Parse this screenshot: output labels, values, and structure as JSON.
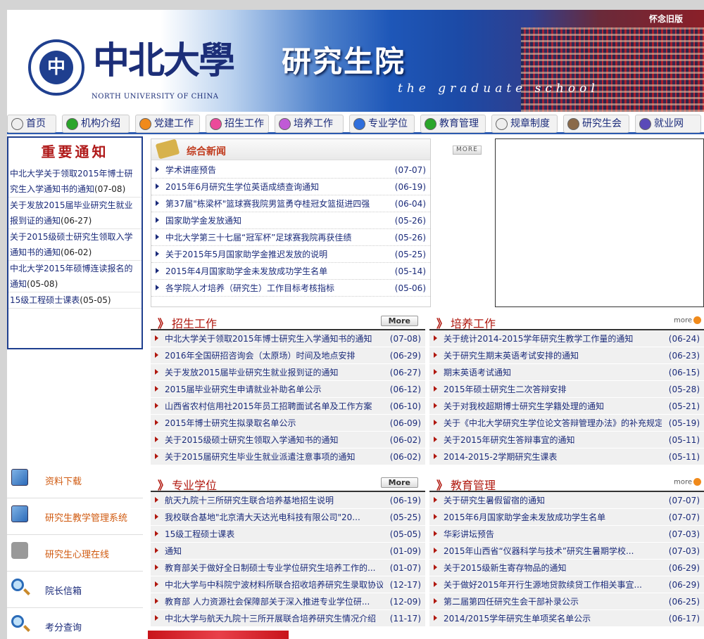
{
  "header": {
    "logo_cn": "中北大學",
    "logo_en": "NORTH UNIVERSITY OF CHINA",
    "title": "研究生院",
    "subtitle_en": "the graduate school",
    "old_version": "怀念旧版"
  },
  "nav": [
    "首页",
    "机构介绍",
    "党建工作",
    "招生工作",
    "培养工作",
    "专业学位",
    "教育管理",
    "规章制度",
    "研究生会",
    "就业网"
  ],
  "nav_colors": [
    "#eeeeee",
    "#2aa52a",
    "#f08a1b",
    "#ec4a9a",
    "#c05ad6",
    "#2f6fdc",
    "#2aa52a",
    "#eeeeee",
    "#8a6a4a",
    "#5a4ab8"
  ],
  "notice": {
    "title": "重要通知",
    "items": [
      {
        "text": "中北大学关于领取2015年博士研究生入学通知书的通知",
        "date": "(07-08)"
      },
      {
        "text": "关于发放2015届毕业研究生就业报到证的通知",
        "date": "(06-27)"
      },
      {
        "text": "关于2015级硕士研究生领取入学通知书的通知",
        "date": "(06-02)"
      },
      {
        "text": "中北大学2015年硕博连读报名的通知",
        "date": "(05-08)"
      },
      {
        "text": "15级工程硕士课表",
        "date": "(05-05)"
      }
    ]
  },
  "left_links": [
    "资料下载",
    "研究生教学管理系统",
    "研究生心理在线",
    "院长信箱",
    "考分查询"
  ],
  "news": {
    "title": "综合新闻",
    "more": "MORE",
    "items": [
      {
        "t": "学术讲座预告",
        "d": "(07-07)"
      },
      {
        "t": "2015年6月研究生学位英语成绩查询通知",
        "d": "(06-19)"
      },
      {
        "t": "第37届\"栋梁杯\"篮球赛我院男篮勇夺桂冠女篮挺进四强",
        "d": "(06-04)"
      },
      {
        "t": "国家助学金发放通知",
        "d": "(05-26)"
      },
      {
        "t": "中北大学第三十七届“冠军杯”足球赛我院再获佳绩",
        "d": "(05-26)"
      },
      {
        "t": "关于2015年5月国家助学金推迟发放的说明",
        "d": "(05-25)"
      },
      {
        "t": "2015年4月国家助学金未发放成功学生名单",
        "d": "(05-14)"
      },
      {
        "t": "各学院人才培养（研究生）工作目标考核指标",
        "d": "(05-06)"
      }
    ]
  },
  "sections": {
    "admission": {
      "title": "招生工作",
      "more": "More",
      "items": [
        {
          "t": "中北大学关于领取2015年博士研究生入学通知书的通知",
          "d": "(07-08)"
        },
        {
          "t": "2016年全国研招咨询会（太原场）时间及地点安排",
          "d": "(06-29)"
        },
        {
          "t": "关于发放2015届毕业研究生就业报到证的通知",
          "d": "(06-27)"
        },
        {
          "t": "2015届毕业研究生申请就业补助名单公示",
          "d": "(06-12)"
        },
        {
          "t": "山西省农村信用社2015年员工招聘面试名单及工作方案",
          "d": "(06-10)"
        },
        {
          "t": "2015年博士研究生拟录取名单公示",
          "d": "(06-09)"
        },
        {
          "t": "关于2015级硕士研究生领取入学通知书的通知",
          "d": "(06-02)"
        },
        {
          "t": "关于2015届研究生毕业生就业派遣注意事项的通知",
          "d": "(06-02)"
        }
      ]
    },
    "training": {
      "title": "培养工作",
      "more": "more",
      "items": [
        {
          "t": "关于统计2014-2015学年研究生教学工作量的通知",
          "d": "(06-24)"
        },
        {
          "t": "关于研究生期末英语考试安排的通知",
          "d": "(06-23)"
        },
        {
          "t": "期末英语考试通知",
          "d": "(06-15)"
        },
        {
          "t": "2015年硕士研究生二次答辩安排",
          "d": "(05-28)"
        },
        {
          "t": "关于对我校超期博士研究生学籍处理的通知",
          "d": "(05-21)"
        },
        {
          "t": "关于《中北大学研究生学位论文答辩管理办法》的补充规定",
          "d": "(05-19)"
        },
        {
          "t": "关于2015年研究生答辩事宜的通知",
          "d": "(05-11)"
        },
        {
          "t": "2014-2015-2学期研究生课表",
          "d": "(05-11)"
        }
      ]
    },
    "degree": {
      "title": "专业学位",
      "more": "More",
      "items": [
        {
          "t": "航天九院十三所研究生联合培养基地招生说明",
          "d": "(06-19)"
        },
        {
          "t": "我校联合基地\"北京清大天达光电科技有限公司\"20...",
          "d": "(05-25)"
        },
        {
          "t": "15级工程硕士课表",
          "d": "(05-05)"
        },
        {
          "t": "通知",
          "d": "(01-09)"
        },
        {
          "t": "教育部关于做好全日制硕士专业学位研究生培养工作的...",
          "d": "(01-07)"
        },
        {
          "t": "中北大学与中科院宁波材料所联合招收培养研究生录取协议",
          "d": "(12-17)"
        },
        {
          "t": "教育部 人力资源社会保障部关于深入推进专业学位研...",
          "d": "(12-09)"
        },
        {
          "t": "中北大学与航天九院十三所开展联合培养研究生情况介绍",
          "d": "(11-17)"
        }
      ]
    },
    "management": {
      "title": "教育管理",
      "more": "more",
      "items": [
        {
          "t": "关于研究生暑假留宿的通知",
          "d": "(07-07)"
        },
        {
          "t": "2015年6月国家助学金未发放成功学生名单",
          "d": "(07-07)"
        },
        {
          "t": "华彩讲坛预告",
          "d": "(07-03)"
        },
        {
          "t": "2015年山西省“仪器科学与技术”研究生暑期学校...",
          "d": "(07-03)"
        },
        {
          "t": "关于2015级新生寄存物品的通知",
          "d": "(06-29)"
        },
        {
          "t": "关于做好2015年开行生源地贷款续贷工作相关事宜...",
          "d": "(06-29)"
        },
        {
          "t": "第二届第四任研究生会干部补录公示",
          "d": "(06-25)"
        },
        {
          "t": "2014/2015学年研究生单项奖名单公示",
          "d": "(06-17)"
        }
      ]
    }
  }
}
